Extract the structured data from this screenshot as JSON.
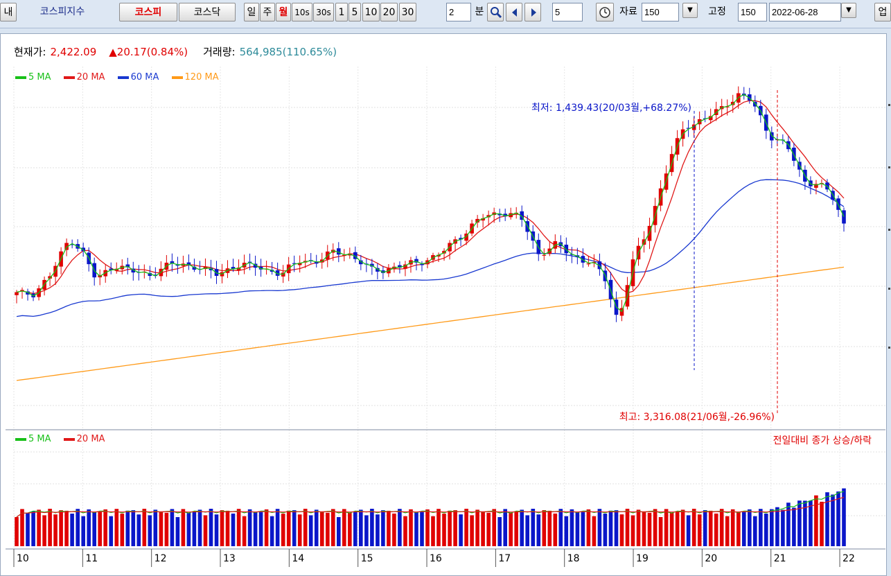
{
  "toolbar": {
    "left_cut_label": "내",
    "index_label": "코스피지수",
    "market_tabs": [
      "코스피",
      "코스닥"
    ],
    "period_buttons": [
      "일",
      "주",
      "월",
      "10s",
      "30s",
      "1",
      "5",
      "10",
      "20",
      "30"
    ],
    "active_period": "월",
    "minute_value": "2",
    "minute_unit": "분",
    "step_value": "5",
    "data_label": "자료",
    "data_count": "150",
    "fixed_label": "고정",
    "fixed_count": "150",
    "date": "2022-06-28",
    "right_cut_label": "업"
  },
  "info": {
    "price_label": "현재가:",
    "price": "2,422.09",
    "change": "▲20.17(0.84%)",
    "volume_label": "거래량:",
    "volume": "564,985(110.65%)"
  },
  "colors": {
    "up": "#e00000",
    "down": "#0a16c9",
    "ma5": "#18c018",
    "ma20": "#e01818",
    "ma60": "#1838d0",
    "ma120": "#ff9a18"
  },
  "legend_price": [
    {
      "label": "5 MA",
      "color": "#18c018"
    },
    {
      "label": "20 MA",
      "color": "#e01818"
    },
    {
      "label": "60 MA",
      "color": "#1838d0"
    },
    {
      "label": "120 MA",
      "color": "#ff9a18"
    }
  ],
  "legend_volume": [
    {
      "label": "5 MA",
      "color": "#18c018"
    },
    {
      "label": "20 MA",
      "color": "#e01818"
    }
  ],
  "volume_note": "전일대비 종가 상승/하락",
  "annotations": {
    "low_text": "최저: 1,439.43(20/03월,+68.27%)",
    "high_text": "최고: 3,316.08(21/06월,-26.96%)"
  },
  "chart_data": {
    "type": "candlestick",
    "x_ticks": [
      "10",
      "11",
      "12",
      "13",
      "14",
      "15",
      "16",
      "17",
      "18",
      "19",
      "20",
      "21",
      "22"
    ],
    "candle_count": 150,
    "summary": {
      "last_close": 2422.09,
      "low": 1439.43,
      "low_period": "20/03",
      "high": 3316.08,
      "high_period": "21/06"
    }
  }
}
